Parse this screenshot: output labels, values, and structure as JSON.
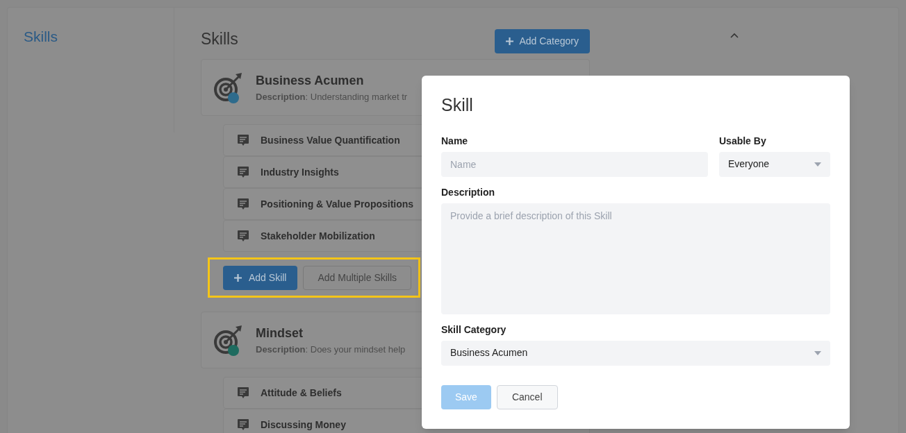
{
  "sidebar": {
    "items": [
      {
        "label": "Skills",
        "selected": true
      }
    ]
  },
  "main": {
    "title": "Skills",
    "add_category_button": "Add Category",
    "categories": [
      {
        "name": "Business Acumen",
        "description": "**Description**: Understanding market tr",
        "color": "#2e6b8c",
        "skills": [
          "Business Value Quantification",
          "Industry Insights",
          "Positioning & Value Propositions",
          "Stakeholder Mobilization"
        ],
        "actions": [
          {
            "label": "Add Skill",
            "kind": "primary"
          },
          {
            "label": "Add Multiple Skills",
            "kind": "secondary"
          }
        ]
      },
      {
        "name": "Mindset",
        "description": "**Description**: Does your mindset help",
        "color": "#1e6b5f",
        "skills": [
          "Attitude & Beliefs",
          "Discussing Money"
        ]
      }
    ]
  },
  "dialog": {
    "title": "Skill",
    "fields": [
      {
        "label": "Name",
        "kind": "text",
        "placeholder": "Name"
      },
      {
        "label": "Usable By",
        "kind": "select",
        "value": "Everyone"
      },
      {
        "label": "Description",
        "kind": "textarea",
        "placeholder": "Provide a brief description of this Skill"
      },
      {
        "label": "Skill Category",
        "kind": "select",
        "value": "Business Acumen"
      }
    ],
    "buttons": [
      {
        "label": "Save",
        "kind": "primary",
        "disabled": true
      },
      {
        "label": "Cancel",
        "kind": "secondary",
        "disabled": false
      }
    ]
  }
}
